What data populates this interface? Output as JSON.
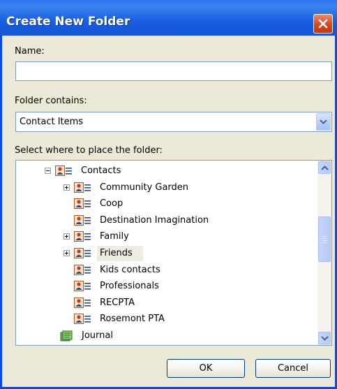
{
  "dialog": {
    "title": "Create New Folder",
    "name_label": "Name:",
    "name_value": "",
    "contains_label": "Folder contains:",
    "contains_value": "Contact Items",
    "select_label": "Select where to place the folder:",
    "ok_label": "OK",
    "cancel_label": "Cancel"
  },
  "tree": {
    "items": [
      {
        "label": "Contacts",
        "expander": "minus",
        "icon": "contact-folder-icon"
      },
      {
        "label": "Community Garden",
        "expander": "plus",
        "icon": "contact-folder-icon"
      },
      {
        "label": "Coop",
        "expander": "none",
        "icon": "contact-folder-icon"
      },
      {
        "label": "Destination Imagination",
        "expander": "none",
        "icon": "contact-folder-icon"
      },
      {
        "label": "Family",
        "expander": "plus",
        "icon": "contact-folder-icon"
      },
      {
        "label": "Friends",
        "expander": "plus",
        "icon": "contact-folder-icon",
        "selected": true
      },
      {
        "label": "Kids contacts",
        "expander": "none",
        "icon": "contact-folder-icon"
      },
      {
        "label": "Professionals",
        "expander": "none",
        "icon": "contact-folder-icon"
      },
      {
        "label": "RECPTA",
        "expander": "none",
        "icon": "contact-folder-icon"
      },
      {
        "label": "Rosemont PTA",
        "expander": "none",
        "icon": "contact-folder-icon"
      },
      {
        "label": "Journal",
        "expander": "none",
        "icon": "journal-folder-icon"
      }
    ]
  },
  "colors": {
    "titlebar": "#1c62e3",
    "close_button": "#d5481f",
    "window_bg": "#ece9d8",
    "selection": "#efece1"
  }
}
